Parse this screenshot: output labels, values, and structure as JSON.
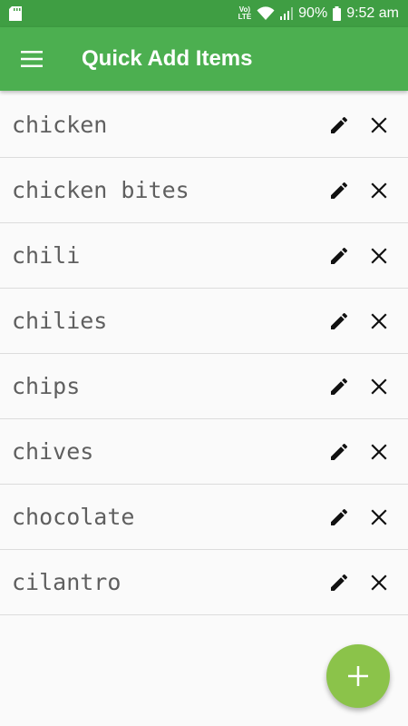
{
  "status_bar": {
    "network_label": "Vo) LTE",
    "battery": "90%",
    "time": "9:52 am",
    "icons": [
      "sd-card-icon",
      "volte-icon",
      "wifi-icon",
      "signal-icon",
      "battery-icon"
    ]
  },
  "app_bar": {
    "title": "Quick Add Items",
    "menu_icon": "hamburger-menu-icon"
  },
  "items": [
    {
      "label": "chicken"
    },
    {
      "label": "chicken bites"
    },
    {
      "label": "chili"
    },
    {
      "label": "chilies"
    },
    {
      "label": "chips"
    },
    {
      "label": "chives"
    },
    {
      "label": "chocolate"
    },
    {
      "label": "cilantro"
    }
  ],
  "row_icons": {
    "edit": "pencil-icon",
    "delete": "close-icon"
  },
  "fab": {
    "icon": "plus-icon",
    "label": "+"
  },
  "colors": {
    "status_bar": "#3f9e43",
    "app_bar": "#4caf50",
    "fab": "#8bc34a",
    "background": "#fafafa",
    "item_text": "#5f5f5f",
    "divider": "#dcdcdc"
  }
}
